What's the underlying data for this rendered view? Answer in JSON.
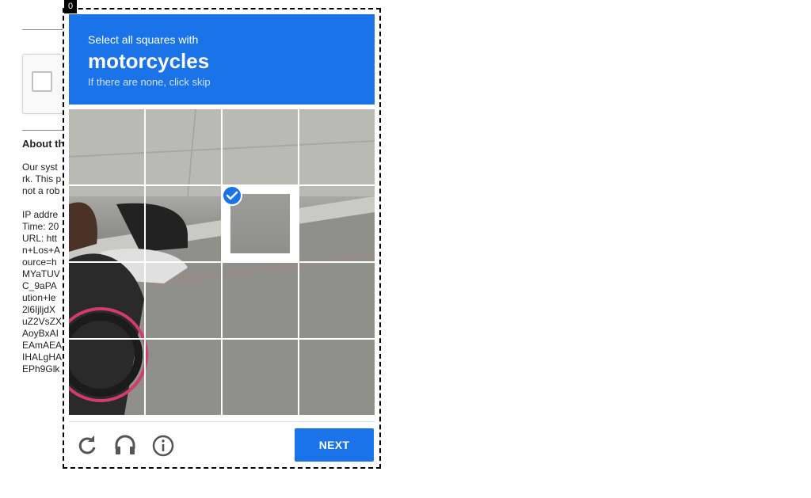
{
  "background_page": {
    "heading": "About th",
    "paragraph_lines": [
      "Our syst",
      "rk. This p",
      "not a rob"
    ],
    "info_lines": [
      "IP addre",
      "Time: 20",
      "URL: htt",
      "n+Los+A",
      "ource=h",
      "MYaTUV",
      "C_9aPA",
      "ution+le",
      "2l6IjljdX",
      "uZ2VsZX",
      "AoyBxAI",
      "EAmAEA",
      "IHALgHA",
      "EPh9Glk"
    ]
  },
  "challenge": {
    "badge": "0",
    "instruction_prefix": "Select all squares with",
    "target": "motorcycles",
    "instruction_sub": "If there are none, click skip",
    "grid": {
      "rows": 4,
      "cols": 4,
      "selected_tiles": [
        6
      ]
    },
    "footer": {
      "reload_icon": "reload-icon",
      "audio_icon": "headphones-icon",
      "info_icon": "info-icon",
      "next_label": "NEXT"
    },
    "colors": {
      "accent": "#1a73e8"
    }
  }
}
